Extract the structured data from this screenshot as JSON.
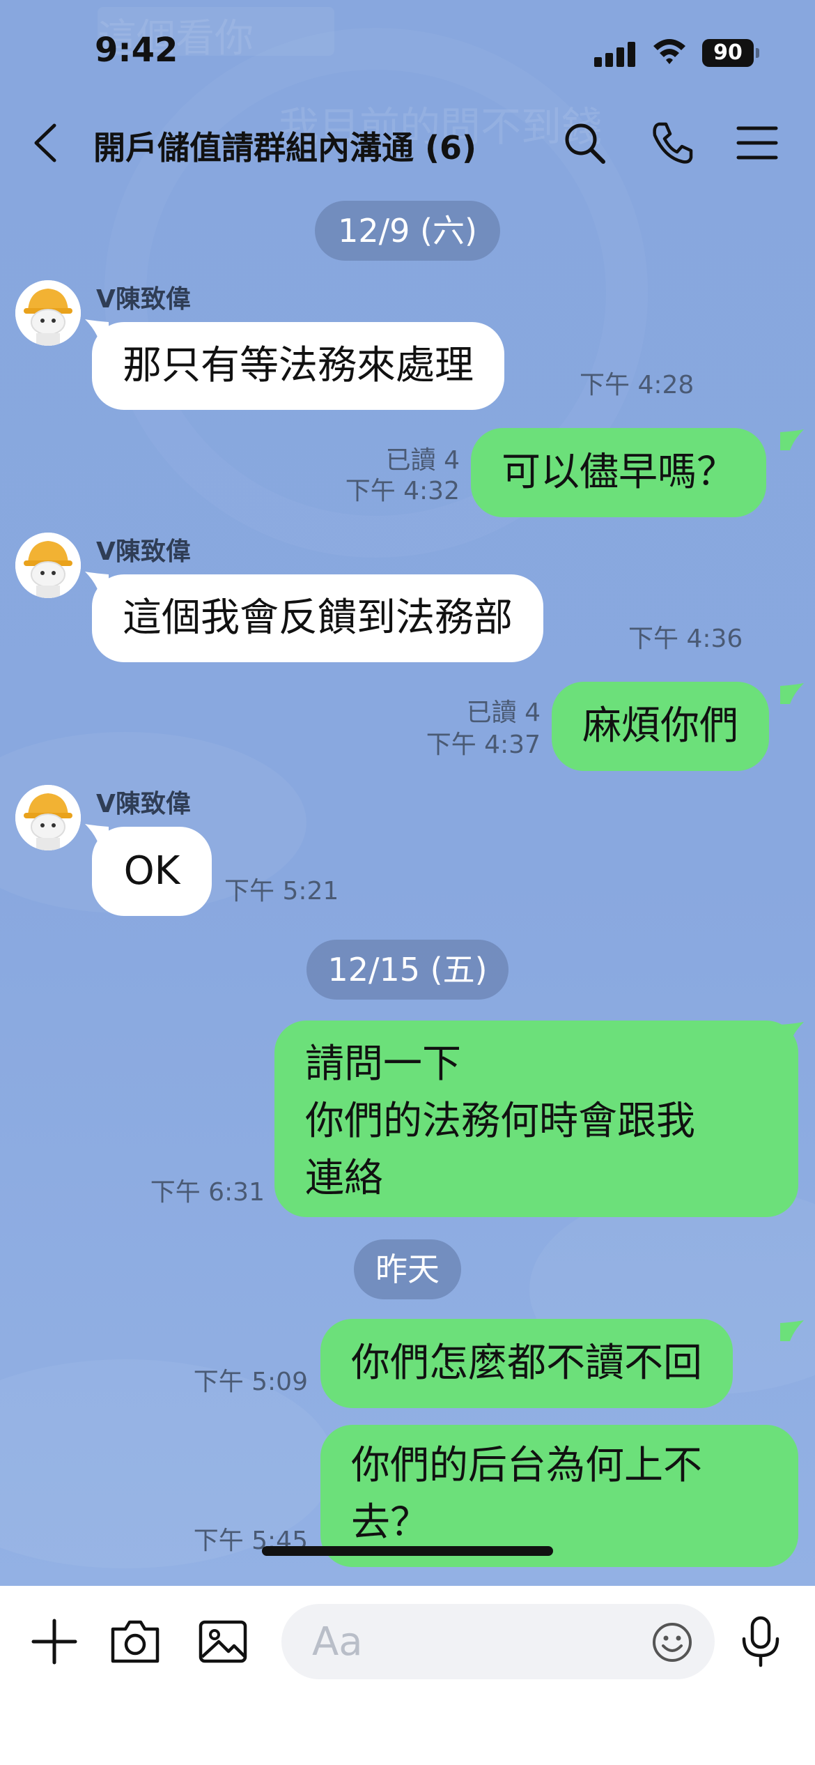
{
  "status_bar": {
    "time": "9:42",
    "battery": "90",
    "icons": [
      "signal-icon",
      "wifi-icon",
      "battery-icon"
    ]
  },
  "header": {
    "title": "開戶儲值請群組內溝通 (6)",
    "icons": [
      "back-chevron-icon",
      "search-icon",
      "phone-icon",
      "menu-icon"
    ]
  },
  "watermark": {
    "line1": "這個看你",
    "line2": "我目前的問不到錢"
  },
  "dates": [
    "12/9 (六)",
    "12/15 (五)",
    "昨天"
  ],
  "messages": [
    {
      "side": "in",
      "sender": "V陳致偉",
      "text": "那只有等法務來處理",
      "time": "下午 4:28"
    },
    {
      "side": "out",
      "text": "可以儘早嗎？",
      "read": "已讀 4",
      "time": "下午 4:32"
    },
    {
      "side": "in",
      "sender": "V陳致偉",
      "text": "這個我會反饋到法務部",
      "time": "下午 4:36"
    },
    {
      "side": "out",
      "text": "麻煩你們",
      "read": "已讀 4",
      "time": "下午 4:37"
    },
    {
      "side": "in",
      "sender": "V陳致偉",
      "text": "OK",
      "time": "下午 5:21"
    },
    {
      "side": "out",
      "lines": [
        "請問一下",
        "你們的法務何時會跟我",
        "連絡"
      ],
      "time": "下午 6:31"
    },
    {
      "side": "out",
      "text": "你們怎麼都不讀不回",
      "time": "下午 5:09"
    },
    {
      "side": "out",
      "lines": [
        "你們的后台為何上不",
        "去？"
      ],
      "time": "下午 5:45"
    }
  ],
  "input_bar": {
    "placeholder": "Aa",
    "icons": [
      "plus-icon",
      "camera-icon",
      "image-icon",
      "emoji-icon",
      "microphone-icon"
    ]
  },
  "colors": {
    "chat_bg": "#89a8df",
    "outgoing_bubble": "#6ce07a",
    "incoming_bubble": "#ffffff",
    "date_chip": "#6e88b8"
  }
}
